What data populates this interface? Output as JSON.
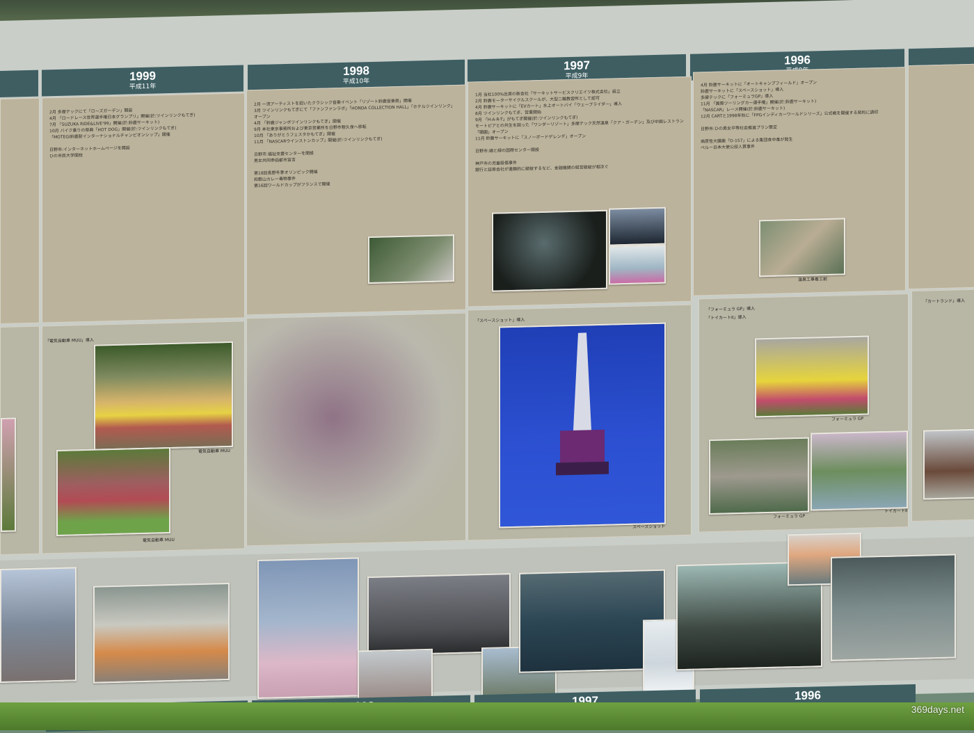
{
  "years": [
    {
      "year": "1999",
      "era": "平成11年"
    },
    {
      "year": "1998",
      "era": "平成10年"
    },
    {
      "year": "1997",
      "era": "平成9年"
    },
    {
      "year": "1996",
      "era": "平成8年"
    }
  ],
  "events": {
    "y1999": "2月 多摩テックにて「ローズガーデン」開設\n4月 「ロードレース世界選手権日本グランプリ」開催(於:ツインリンクもてぎ)\n7月 「SUZUKA RIDE&LIVE'99」開催(於:鈴鹿サーキット)\n10月 バイク乗りの祭典「HOT DOG」開催(於:ツインリンクもてぎ)\n「MOTEGI鈴鹿耐インターナショナルチャンピオンシップ」開催\n\n日野市:インターネットホームページを開設\nひの市民大学開校",
    "y1998": "2月 一流アーティストを招いたクラシック音楽イベント「リゾート鈴鹿音楽祭」開催\n3月 ツインリンクもてぎにて「ファンファンラボ」「HONDA COLLECTION HALL」「ホテルツインリンク」オープン\n4月 「鈴鹿ジャンボツインリンクもてぎ」開催\n9月 本社東京事務所および東京営業所を日野市程久保へ移転\n10月 「ありがとうフェスタかもてぎ」開催\n11月 「NASCARウインストンカップ」開催(於:ツインリンクもてぎ)\n\n日野市:福祉支援センターを開設\n男女共同参画都市宣言\n\n第18回長野冬季オリンピック開催\n和歌山カレー毒物事件\n第16回ワールドカップがフランスで開催",
    "y1997": "1月 当社100%出資の新会社「サーキットサービスクリエイツ株式会社」設立\n2月 鈴鹿モーターサイクルスクールが、大型二輪教習所として認可\n4月 鈴鹿サーキットに「EVカート」水上オートバイ「ウェーブライダー」導入\n8月 ツインリンクもてぎ、営業開始\n9月 「H-A-R-T」がもてぎ開催(於:ツインリンクもてぎ)\nモートピアとの共生を図った「ワンダーリゾート」多摩テック天然温泉「クア・ガーデン」及び中国レストラン「頤園」オープン\n11月 鈴鹿サーキットに「スノーボードゲレンデ」オープン\n\n日野市:鶏と緑の国際センター開設\n\n神戸市の児童殺傷事件\n銀行と証券会社が連鎖的に破綻するなど、金融機関の経営破綻が相次ぐ",
    "y1996": "4月 鈴鹿サーキットに「オートキャンプフィールド」オープン\n鈴鹿サーキットに「スペースショット」導入\n多摩テックに「フォーミュラGP」導入\n11月 「国際ツーリングカー選手権」開催(於:鈴鹿サーキット)\n「NASCAR」レース開催(於:鈴鹿サーキット)\n12月 CARTと1998年秋に「FPGインディカーワールドシリーズ」公式戦を開催する契約に調印\n\n日野市:ひの男女平等社会推進プラン策定\n\n病原性大腸菌「O-157」による集団食中毒が発生\nペルー日本大使公邸人質事件"
  },
  "captions": {
    "muu_intro": "「電気自動車 MUU」導入",
    "muu_1": "電気自動車 MUU",
    "muu_2": "電気自動車 MUU",
    "space_shot_intro": "「スペースショット」導入",
    "space_shot": "スペースショット",
    "formula_intro": "「フォーミュラ GP」導入",
    "toy_kart_intro": "「トイカートII」導入",
    "formula_gp_1": "フォーミュラ GP",
    "formula_gp_2": "フォーミュラ GP",
    "toy_kart": "トイカートII",
    "onsen": "温泉工事着工前",
    "cart_land": "「カートランド」導入"
  },
  "watermark": "369days.net"
}
